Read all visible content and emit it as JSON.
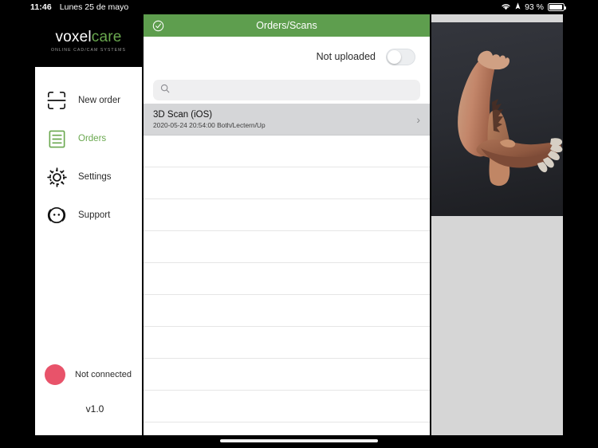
{
  "status_bar": {
    "time": "11:46",
    "date": "Lunes 25 de mayo",
    "wifi_icon": "wifi-icon",
    "location_icon": "location-icon",
    "battery_percent": "93 %",
    "battery_icon": "battery-icon"
  },
  "brand": {
    "name_part1": "voxel",
    "name_part2": "care",
    "tagline": "ONLINE CAD/CAM SYSTEMS",
    "accent_color": "#6aa84f"
  },
  "sidebar": {
    "items": [
      {
        "label": "New order",
        "icon": "scan-frame-icon",
        "active": false
      },
      {
        "label": "Orders",
        "icon": "list-document-icon",
        "active": true
      },
      {
        "label": "Settings",
        "icon": "gear-icon",
        "active": false
      },
      {
        "label": "Support",
        "icon": "headset-face-icon",
        "active": false
      }
    ],
    "connection": {
      "label": "Not connected",
      "status_color": "#e8536a"
    },
    "version": "v1.0"
  },
  "main": {
    "header": {
      "title": "Orders/Scans",
      "left_icon": "check-circle-icon",
      "background_color": "#5e9e4e"
    },
    "filter": {
      "label": "Not uploaded",
      "toggle_state": "off"
    },
    "search": {
      "value": "",
      "placeholder": "",
      "icon": "search-icon"
    },
    "list": {
      "rows": [
        {
          "title": "3D Scan (iOS)",
          "subtitle": "2020-05-24 20:54:00 Both/Lectern/Up",
          "selected": true,
          "chevron": "›"
        },
        {
          "title": "",
          "subtitle": "",
          "selected": false,
          "chevron": ""
        },
        {
          "title": "",
          "subtitle": "",
          "selected": false,
          "chevron": ""
        },
        {
          "title": "",
          "subtitle": "",
          "selected": false,
          "chevron": ""
        },
        {
          "title": "",
          "subtitle": "",
          "selected": false,
          "chevron": ""
        },
        {
          "title": "",
          "subtitle": "",
          "selected": false,
          "chevron": ""
        },
        {
          "title": "",
          "subtitle": "",
          "selected": false,
          "chevron": ""
        },
        {
          "title": "",
          "subtitle": "",
          "selected": false,
          "chevron": ""
        },
        {
          "title": "",
          "subtitle": "",
          "selected": false,
          "chevron": ""
        },
        {
          "title": "",
          "subtitle": "",
          "selected": false,
          "chevron": ""
        }
      ]
    }
  },
  "viewer": {
    "model_name": "3d-foot-scan",
    "background_color": "#2b2d33",
    "model_color": "#c98a6b"
  }
}
